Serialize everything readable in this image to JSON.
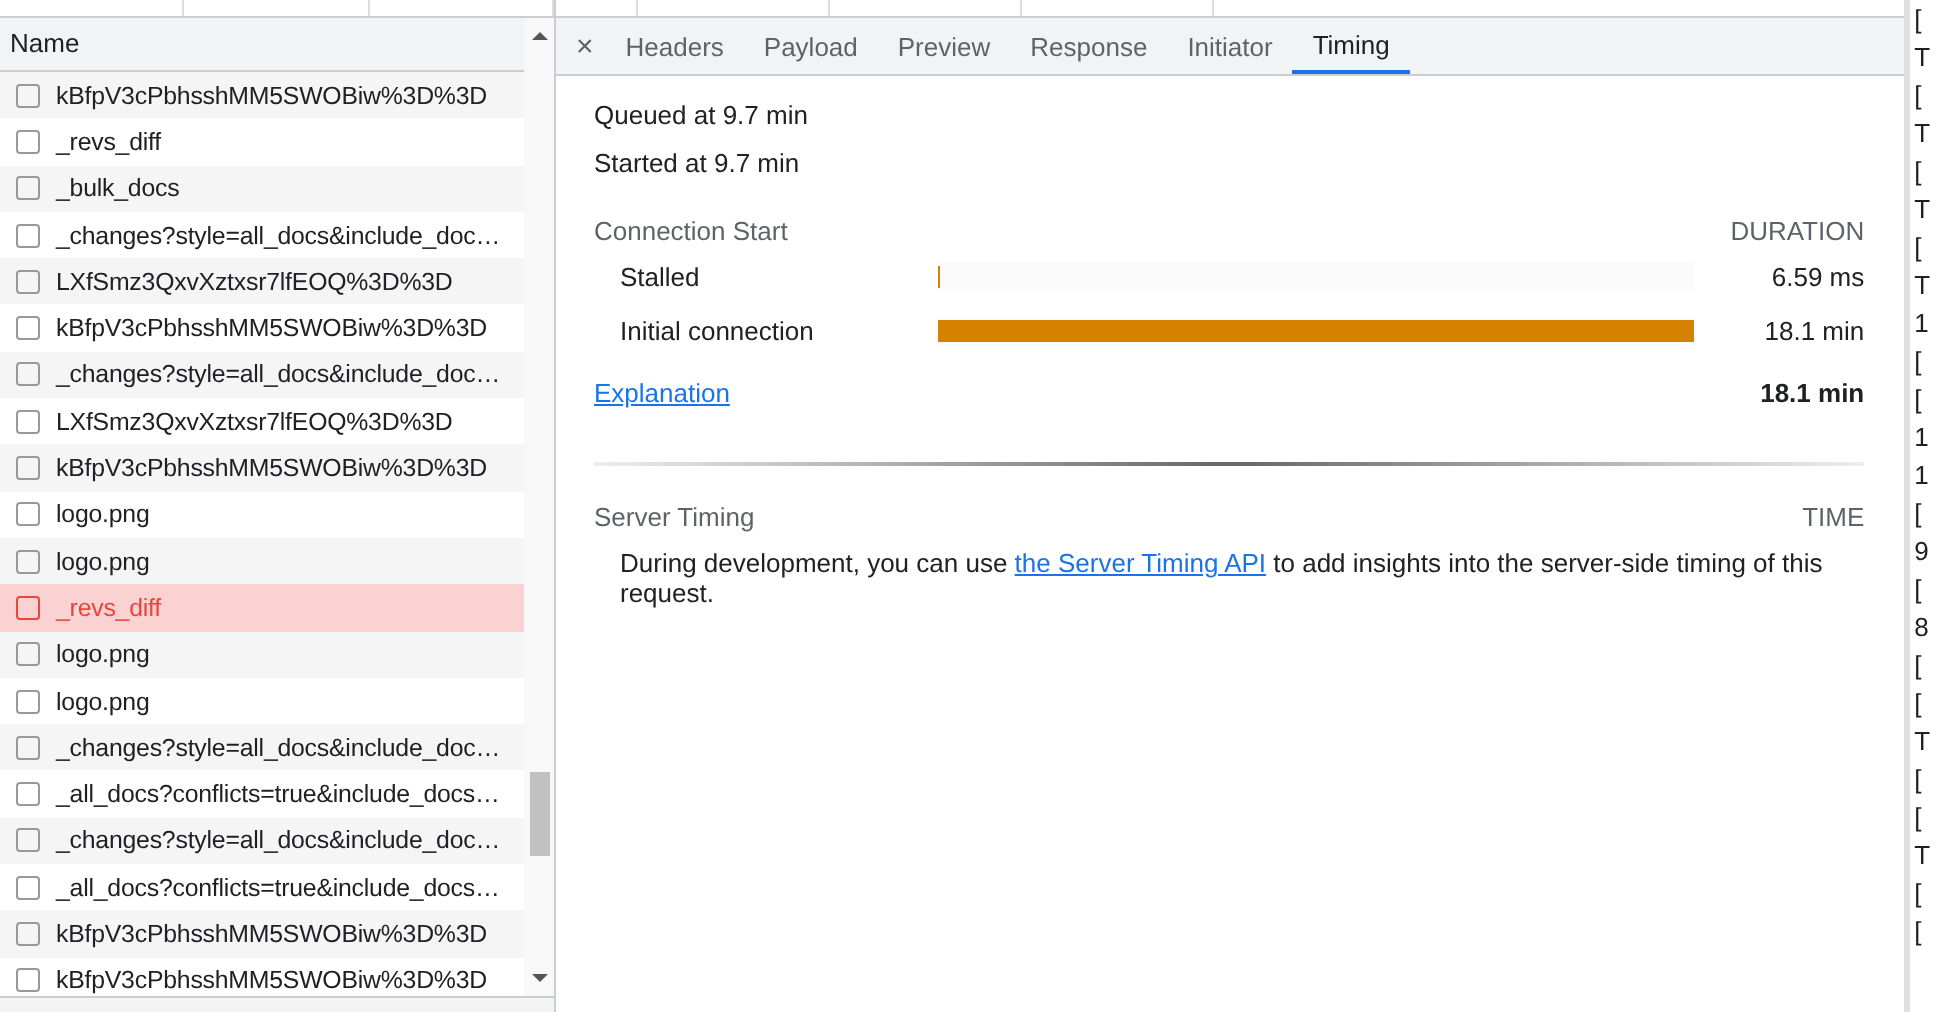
{
  "request_list": {
    "column_header": "Name",
    "rows": [
      {
        "name": "kBfpV3cPbhsshMM5SWOBiw%3D%3D",
        "error": false
      },
      {
        "name": "_revs_diff",
        "error": false
      },
      {
        "name": "_bulk_docs",
        "error": false
      },
      {
        "name": "_changes?style=all_docs&include_doc…",
        "error": false
      },
      {
        "name": "LXfSmz3QxvXztxsr7lfEOQ%3D%3D",
        "error": false
      },
      {
        "name": "kBfpV3cPbhsshMM5SWOBiw%3D%3D",
        "error": false
      },
      {
        "name": "_changes?style=all_docs&include_doc…",
        "error": false
      },
      {
        "name": "LXfSmz3QxvXztxsr7lfEOQ%3D%3D",
        "error": false
      },
      {
        "name": "kBfpV3cPbhsshMM5SWOBiw%3D%3D",
        "error": false
      },
      {
        "name": "logo.png",
        "error": false
      },
      {
        "name": "logo.png",
        "error": false
      },
      {
        "name": "_revs_diff",
        "error": true
      },
      {
        "name": "logo.png",
        "error": false
      },
      {
        "name": "logo.png",
        "error": false
      },
      {
        "name": "_changes?style=all_docs&include_doc…",
        "error": false
      },
      {
        "name": "_all_docs?conflicts=true&include_docs…",
        "error": false
      },
      {
        "name": "_changes?style=all_docs&include_doc…",
        "error": false
      },
      {
        "name": "_all_docs?conflicts=true&include_docs…",
        "error": false
      },
      {
        "name": "kBfpV3cPbhsshMM5SWOBiw%3D%3D",
        "error": false
      },
      {
        "name": "kBfpV3cPbhsshMM5SWOBiw%3D%3D",
        "error": false
      }
    ]
  },
  "detail": {
    "close": "×",
    "tabs": [
      {
        "label": "Headers",
        "selected": false
      },
      {
        "label": "Payload",
        "selected": false
      },
      {
        "label": "Preview",
        "selected": false
      },
      {
        "label": "Response",
        "selected": false
      },
      {
        "label": "Initiator",
        "selected": false
      },
      {
        "label": "Timing",
        "selected": true
      }
    ],
    "queued": "Queued at 9.7 min",
    "started": "Started at 9.7 min",
    "section_title": "Connection Start",
    "duration_header": "DURATION",
    "phases": [
      {
        "name": "Stalled",
        "level": 0.003,
        "reading": "6.59 ms"
      },
      {
        "name": "Initial connection",
        "level": 1,
        "reading": "18.1 min"
      }
    ],
    "explanation_link": "Explanation",
    "total": "18.1 min",
    "server_timing": {
      "title": "Server Timing",
      "time_header": "TIME",
      "text_before": "During development, you can use ",
      "link": "the Server Timing API",
      "text_after": " to add insights into the server-side timing of this request."
    }
  },
  "side_fragments": [
    "[",
    "T",
    "[",
    "T",
    "[",
    "T",
    "[",
    "T",
    "1",
    "[",
    "[",
    "1",
    "1",
    "[",
    "9",
    "[",
    "8",
    "[",
    "[",
    "T",
    "[",
    "[",
    "T",
    "[",
    "["
  ]
}
